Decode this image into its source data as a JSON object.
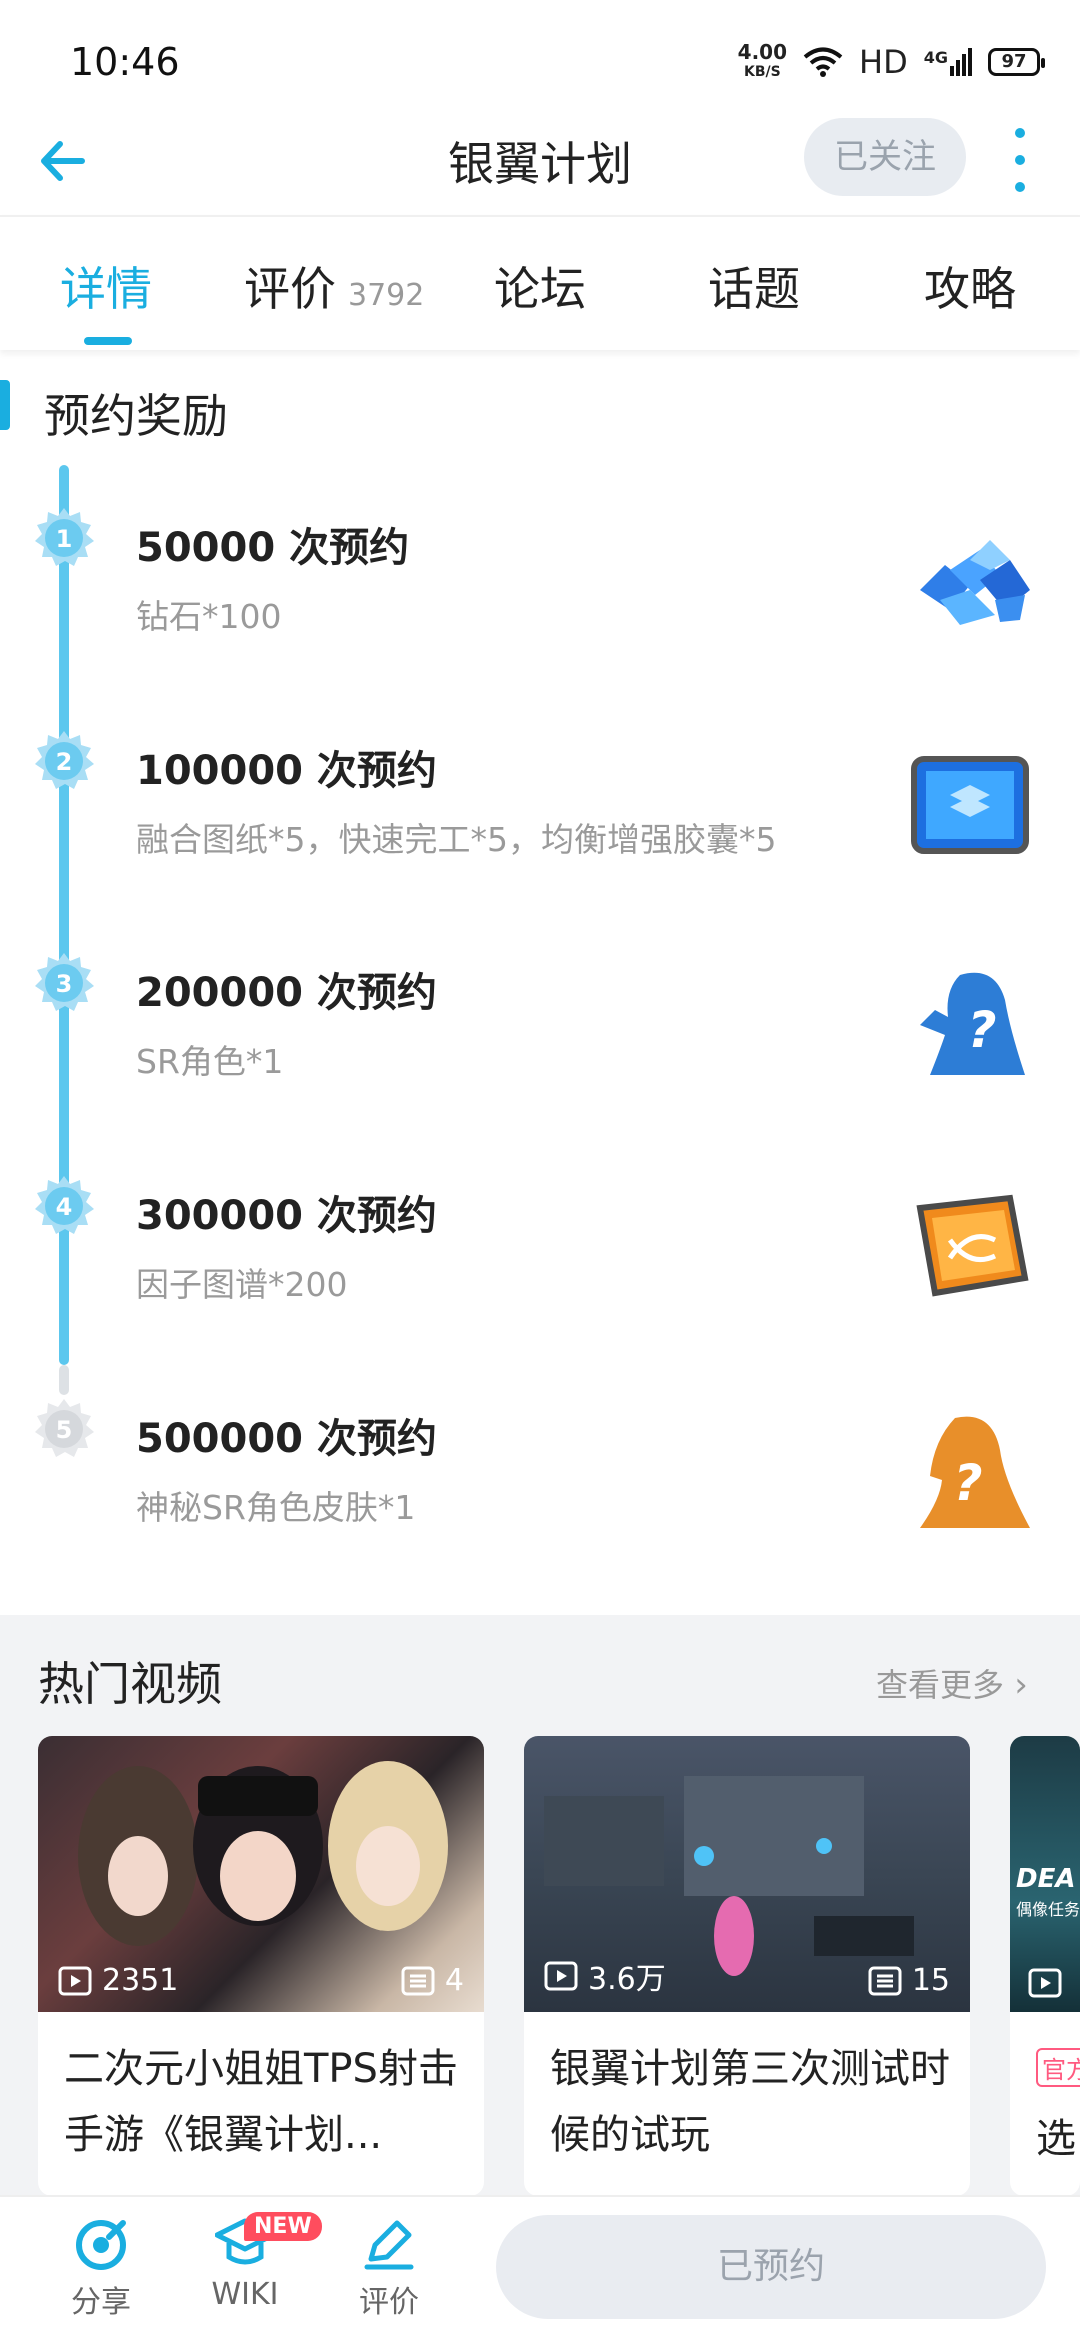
{
  "status_bar": {
    "time": "10:46",
    "net_speed": "4.00",
    "net_unit": "KB/S",
    "hd": "HD",
    "signal": "4G",
    "battery": "97"
  },
  "header": {
    "title": "银翼计划",
    "follow_label": "已关注"
  },
  "tabs": [
    {
      "label": "详情",
      "active": true
    },
    {
      "label": "评价",
      "count": "3792"
    },
    {
      "label": "论坛"
    },
    {
      "label": "话题"
    },
    {
      "label": "攻略"
    }
  ],
  "rewards": {
    "section_title": "预约奖励",
    "items": [
      {
        "index": "1",
        "title": "50000 次预约",
        "desc": "钻石*100",
        "icon": "diamond-pile-icon",
        "reached": true
      },
      {
        "index": "2",
        "title": "100000 次预约",
        "desc": "融合图纸*5，快速完工*5，均衡增强胶囊*5",
        "icon": "blueprint-icon",
        "reached": true
      },
      {
        "index": "3",
        "title": "200000 次预约",
        "desc": "SR角色*1",
        "icon": "mystery-character-icon",
        "reached": true
      },
      {
        "index": "4",
        "title": "300000 次预约",
        "desc": "因子图谱*200",
        "icon": "dna-chip-icon",
        "reached": true
      },
      {
        "index": "5",
        "title": "500000 次预约",
        "desc": "神秘SR角色皮肤*1",
        "icon": "mystery-skin-icon",
        "reached": false
      }
    ]
  },
  "hot_videos": {
    "title": "热门视频",
    "more_label": "查看更多",
    "items": [
      {
        "plays": "2351",
        "episodes": "4",
        "caption": "二次元小姐姐TPS射击手游《银翼计划..."
      },
      {
        "plays": "3.6万",
        "episodes": "15",
        "caption": "银翼计划第三次测试时候的试玩"
      },
      {
        "thumb_text": "DEA",
        "thumb_sub": "偶像任务",
        "tag": "官方",
        "caption": "选"
      }
    ]
  },
  "bottom_bar": {
    "share_label": "分享",
    "wiki_label": "WIKI",
    "wiki_badge": "NEW",
    "review_label": "评价",
    "reserve_label": "已预约"
  },
  "colors": {
    "accent": "#1aaee0",
    "timeline": "#5cc7ee",
    "badge_done": "#7fd0f2",
    "badge_pending": "#dcdfe3"
  }
}
